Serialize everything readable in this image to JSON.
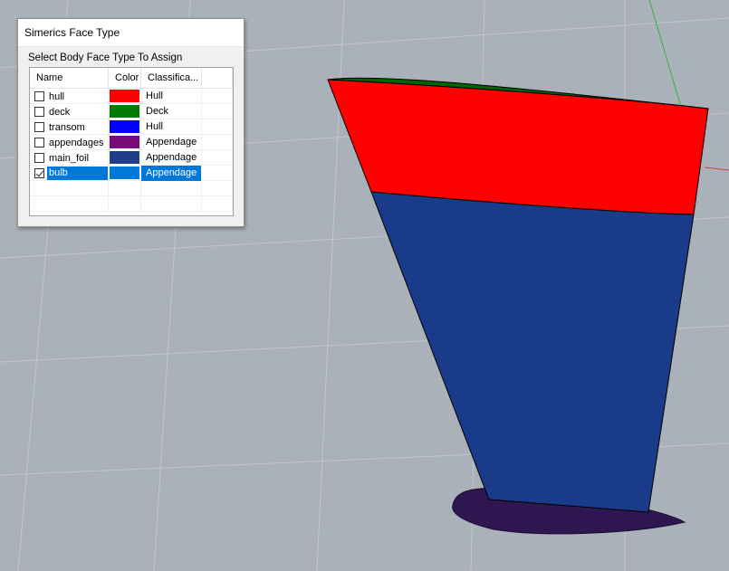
{
  "dialog": {
    "title": "Simerics Face Type",
    "group_label": "Select Body Face Type To Assign",
    "columns": [
      "Name",
      "Color",
      "Classifica..."
    ],
    "rows": [
      {
        "name": "hull",
        "color": "#ff0000",
        "classification": "Hull",
        "checked": false,
        "selected": false
      },
      {
        "name": "deck",
        "color": "#007a00",
        "classification": "Deck",
        "checked": false,
        "selected": false
      },
      {
        "name": "transom",
        "color": "#0000ff",
        "classification": "Hull",
        "checked": false,
        "selected": false
      },
      {
        "name": "appendages",
        "color": "#7a0a7a",
        "classification": "Appendage",
        "checked": false,
        "selected": false
      },
      {
        "name": "main_foil",
        "color": "#1f3d8a",
        "classification": "Appendage",
        "checked": false,
        "selected": false
      },
      {
        "name": "bulb",
        "color": "#0078d7",
        "classification": "Appendage",
        "checked": true,
        "selected": true
      }
    ]
  },
  "model": {
    "hull_color": "#ff0000",
    "deck_color": "#006400",
    "foil_color": "#1a3a8a",
    "bulb_color": "#2e1650",
    "background_color": "#aab1b9",
    "grid_color": "#c4c8cd"
  }
}
